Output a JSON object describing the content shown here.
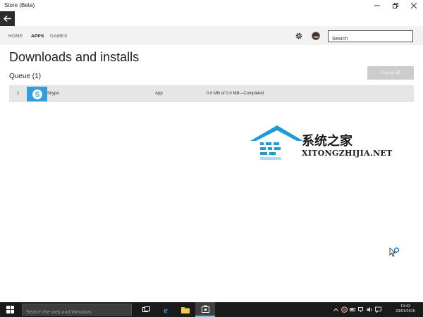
{
  "window": {
    "title": "Store (Beta)"
  },
  "nav": {
    "tabs": [
      {
        "label": "HOME",
        "active": false
      },
      {
        "label": "APPS",
        "active": true
      },
      {
        "label": "GAMES",
        "active": false
      }
    ],
    "search_placeholder": "Search"
  },
  "page": {
    "title": "Downloads and installs",
    "queue_title": "Queue (1)",
    "pause_label": "Pause all"
  },
  "queue": [
    {
      "index": "1",
      "name": "Skype",
      "type": "App",
      "status": "0.0 MB of 0.0 MB—Completed"
    }
  ],
  "watermark": {
    "title": "系统之家",
    "url": "XITONGZHIJIA.NET"
  },
  "taskbar": {
    "search_placeholder": "Search the web and Windows",
    "time": "13:43",
    "date": "23/01/2015"
  },
  "colors": {
    "accent": "#2d9ee0",
    "nav_bg": "#f2f2f2",
    "row_bg": "#e6e6e6",
    "taskbar_bg": "#1a1a1a",
    "back_button": "#2b2b2b"
  },
  "icons": [
    "back-arrow-icon",
    "gear-icon",
    "skype-icon",
    "windows-logo-icon",
    "task-view-icon",
    "edge-icon",
    "file-explorer-icon",
    "store-icon"
  ]
}
